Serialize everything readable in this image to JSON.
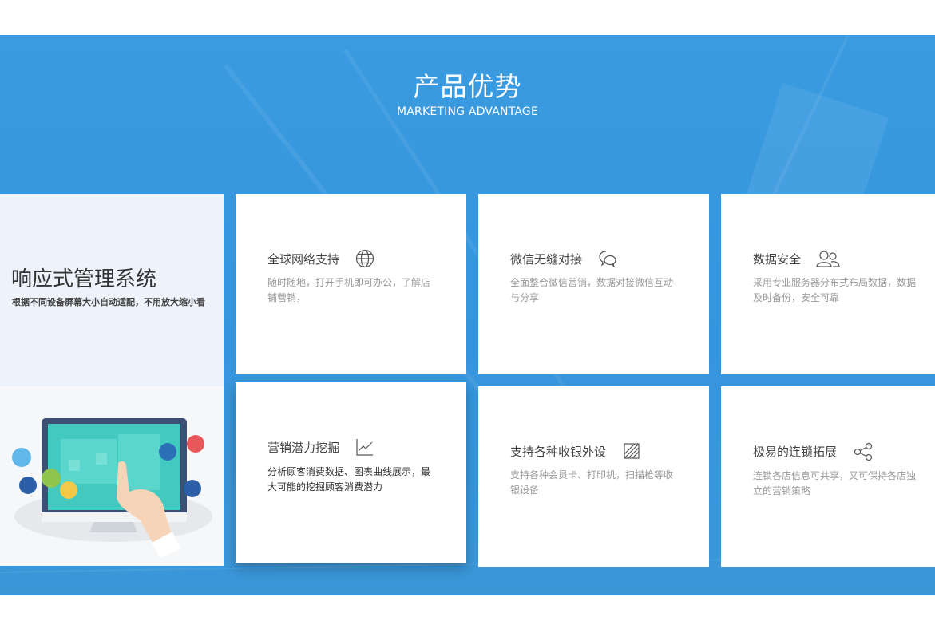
{
  "section": {
    "title_zh": "产品优势",
    "title_en": "MARKETING ADVANTAGE"
  },
  "promo": {
    "title": "响应式管理系统",
    "subtitle": "根据不同设备屏幕大小自动适配，不用放大缩小看"
  },
  "cards": [
    {
      "title": "全球网络支持",
      "icon": "globe-icon",
      "desc": "随时随地，打开手机即可办公，了解店铺营销，"
    },
    {
      "title": "微信无缝对接",
      "icon": "chat-bubble-icon",
      "desc": "全面整合微信营销，数据对接微信互动与分享"
    },
    {
      "title": "数据安全",
      "icon": "users-icon",
      "desc": "采用专业服务器分布式布局数据，数据及时备份，安全可靠"
    },
    {
      "title": "营销潜力挖掘",
      "icon": "line-chart-icon",
      "desc": "分析顾客消费数据、图表曲线展示，最大可能的挖掘顾客消费潜力"
    },
    {
      "title": "支持各种收银外设",
      "icon": "card-reader-icon",
      "desc": "支持各种会员卡、打印机，扫描枪等收银设备"
    },
    {
      "title": "极易的连锁拓展",
      "icon": "share-icon",
      "desc": "连锁各店信息可共享，又可保持各店独立的营销策略"
    }
  ],
  "colors": {
    "band": "#3595dc",
    "card_bg": "#ffffff",
    "promo_bg": "#eef2fa"
  }
}
